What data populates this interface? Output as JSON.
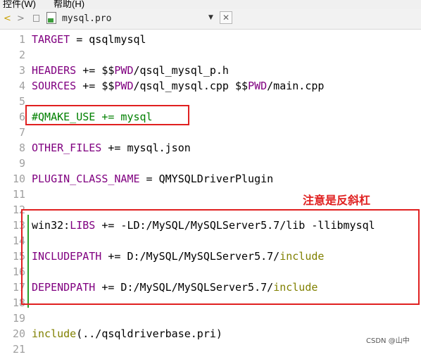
{
  "menubar": {
    "items": [
      "控件(W)",
      "帮助(H)"
    ]
  },
  "tab": {
    "back": "<",
    "forward": ">",
    "filename": "mysql.pro",
    "dropdown": "▼",
    "close": "✕"
  },
  "editor": {
    "lines": [
      {
        "n": "1",
        "text": "TARGET = qsqlmysql"
      },
      {
        "n": "2",
        "text": ""
      },
      {
        "n": "3",
        "text": "HEADERS += $$PWD/qsql_mysql_p.h"
      },
      {
        "n": "4",
        "text": "SOURCES += $$PWD/qsql_mysql.cpp $$PWD/main.cpp"
      },
      {
        "n": "5",
        "text": ""
      },
      {
        "n": "6",
        "text": "#QMAKE_USE += mysql"
      },
      {
        "n": "7",
        "text": ""
      },
      {
        "n": "8",
        "text": "OTHER_FILES += mysql.json"
      },
      {
        "n": "9",
        "text": ""
      },
      {
        "n": "10",
        "text": "PLUGIN_CLASS_NAME = QMYSQLDriverPlugin"
      },
      {
        "n": "11",
        "text": ""
      },
      {
        "n": "12",
        "text": ""
      },
      {
        "n": "13",
        "text": "win32:LIBS += -LD:/MySQL/MySQLServer5.7/lib -llibmysql"
      },
      {
        "n": "14",
        "text": ""
      },
      {
        "n": "15",
        "text": "INCLUDEPATH += D:/MySQL/MySQLServer5.7/include"
      },
      {
        "n": "16",
        "text": ""
      },
      {
        "n": "17",
        "text": "DEPENDPATH += D:/MySQL/MySQLServer5.7/include"
      },
      {
        "n": "18",
        "text": ""
      },
      {
        "n": "19",
        "text": ""
      },
      {
        "n": "20",
        "text": "include(../qsqldriverbase.pri)"
      },
      {
        "n": "21",
        "text": ""
      }
    ]
  },
  "annotation": {
    "note": "注意是反斜杠"
  },
  "watermark": "CSDN @山中"
}
